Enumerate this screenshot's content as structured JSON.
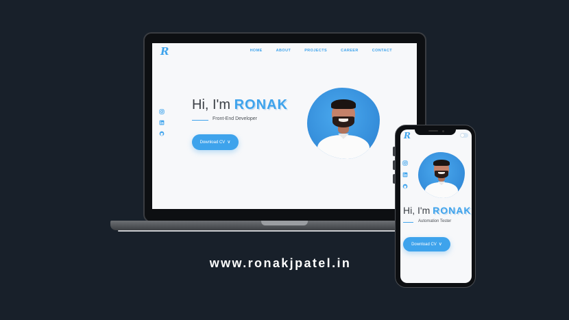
{
  "site": {
    "logo": "R",
    "nav": [
      "HOME",
      "ABOUT",
      "PROJECTS",
      "CAREER",
      "CONTACT"
    ],
    "greeting": "Hi, I'm",
    "name": "RONAK",
    "desktop_role": "Front-End Developer",
    "mobile_role": "Automation Tester",
    "download_label": "Download CV",
    "download_icon": "double-chevron-down-icon",
    "social_icons": [
      "instagram-icon",
      "linkedin-icon",
      "github-icon"
    ]
  },
  "url": "www.ronakjpatel.in",
  "colors": {
    "background": "#18202a",
    "accent": "#3ea3ec",
    "screen": "#f7f8fa"
  }
}
